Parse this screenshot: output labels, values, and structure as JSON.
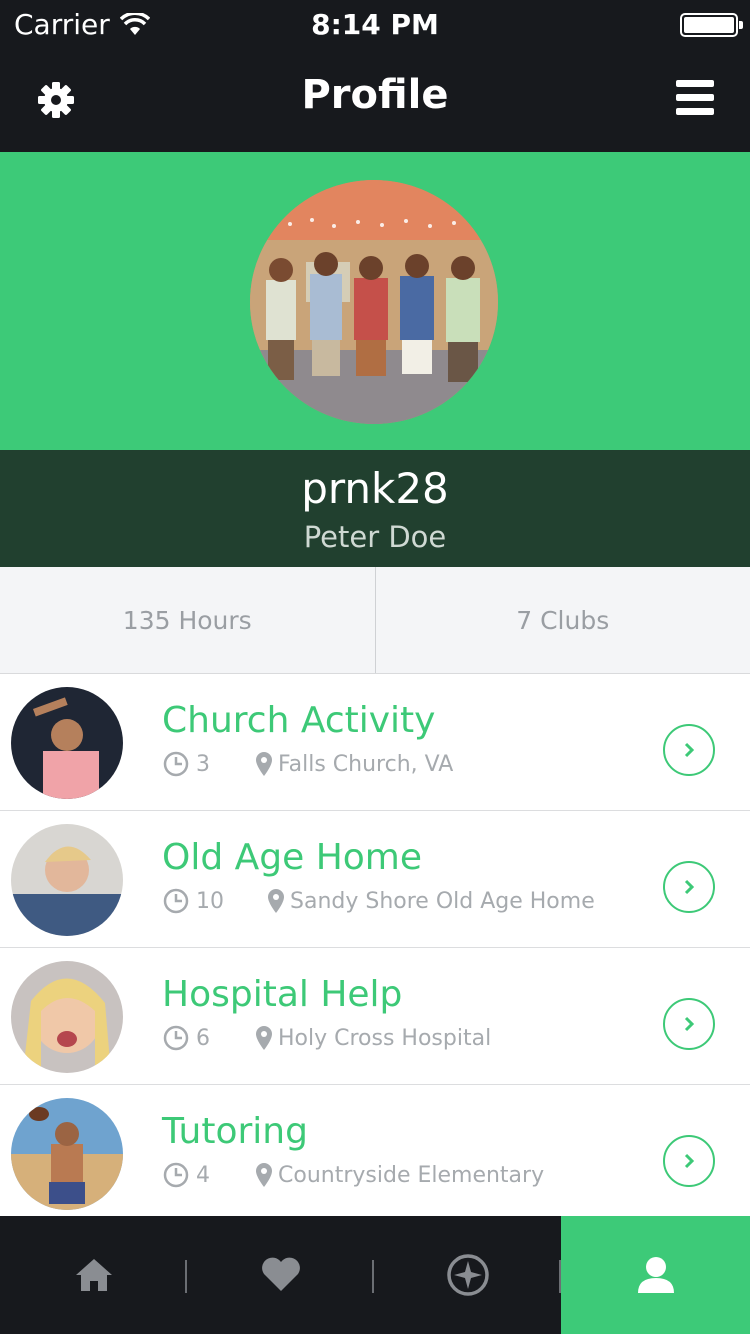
{
  "status_bar": {
    "carrier": "Carrier",
    "time": "8:14 PM"
  },
  "nav": {
    "title": "Profile",
    "settings_icon": "gear-icon",
    "menu_icon": "hamburger-menu-icon"
  },
  "profile": {
    "username": "prnk28",
    "full_name": "Peter Doe",
    "photo": "group-photo"
  },
  "stats": {
    "hours": "135 Hours",
    "clubs": "7 Clubs"
  },
  "activities": [
    {
      "title": "Church Activity",
      "hours": "3",
      "location": "Falls Church, VA"
    },
    {
      "title": "Old Age Home",
      "hours": "10",
      "location": "Sandy Shore Old Age Home"
    },
    {
      "title": "Hospital Help",
      "hours": "6",
      "location": "Holy Cross Hospital"
    },
    {
      "title": "Tutoring",
      "hours": "4",
      "location": "Countryside Elementary"
    }
  ],
  "tabs": [
    {
      "icon": "home-icon",
      "active": false
    },
    {
      "icon": "heart-icon",
      "active": false
    },
    {
      "icon": "compass-icon",
      "active": false
    },
    {
      "icon": "profile-icon",
      "active": true
    }
  ],
  "colors": {
    "accent": "#3dca78",
    "dark": "#17191d",
    "name_band": "#21402f"
  }
}
